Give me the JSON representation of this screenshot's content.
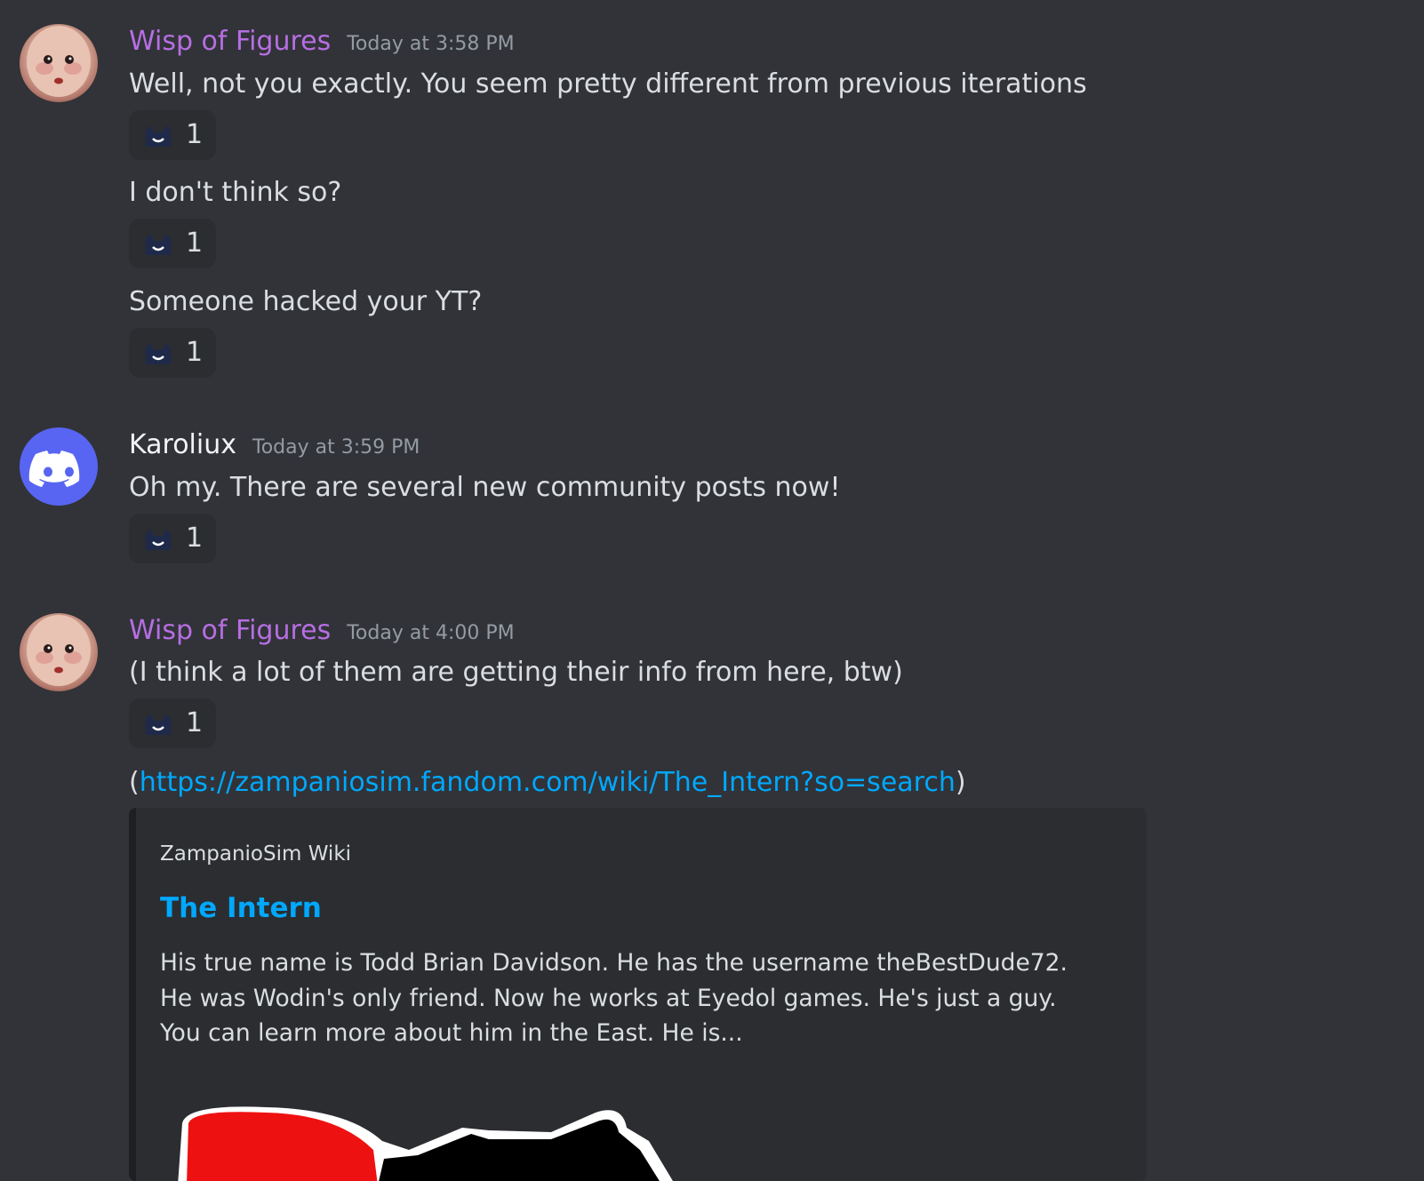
{
  "colors": {
    "background": "#313338",
    "wisp_name": "#b76ee2",
    "karoliux_name": "#f2f3f5",
    "link": "#00a8fc",
    "timestamp": "#949ba4",
    "discord_blurple": "#5865f2"
  },
  "messages": [
    {
      "author": "Wisp of Figures",
      "timestamp": "Today at 3:58 PM",
      "avatar": "doll-face-avatar",
      "lines": [
        {
          "text": "Well, not you exactly. You seem pretty different from previous iterations",
          "reaction": {
            "emoji": "hooded-smile-emoji",
            "count": "1"
          }
        },
        {
          "text": "I don't think so?",
          "reaction": {
            "emoji": "hooded-smile-emoji",
            "count": "1"
          }
        },
        {
          "text": "Someone hacked your YT?",
          "reaction": {
            "emoji": "hooded-smile-emoji",
            "count": "1"
          }
        }
      ]
    },
    {
      "author": "Karoliux",
      "timestamp": "Today at 3:59 PM",
      "avatar": "discord-default-avatar",
      "lines": [
        {
          "text": "Oh my. There are several new community posts now!",
          "reaction": {
            "emoji": "hooded-smile-emoji",
            "count": "1"
          }
        }
      ]
    },
    {
      "author": "Wisp of Figures",
      "timestamp": "Today at 4:00 PM",
      "avatar": "doll-face-avatar",
      "lines": [
        {
          "text": "(I think a lot of them are getting their info from here, btw)",
          "reaction": {
            "emoji": "hooded-smile-emoji",
            "count": "1"
          }
        },
        {
          "prefix": "(",
          "link": "https://zampaniosim.fandom.com/wiki/The_Intern?so=search",
          "suffix": ")"
        }
      ],
      "embed": {
        "provider": "ZampanioSim Wiki",
        "title": "The Intern",
        "description": "His true name is Todd Brian Davidson. He has the username theBestDude72. He was Wodin's only friend. Now he works at Eyedol games. He's just a guy. You can learn more about him in the East. He is..."
      }
    }
  ]
}
